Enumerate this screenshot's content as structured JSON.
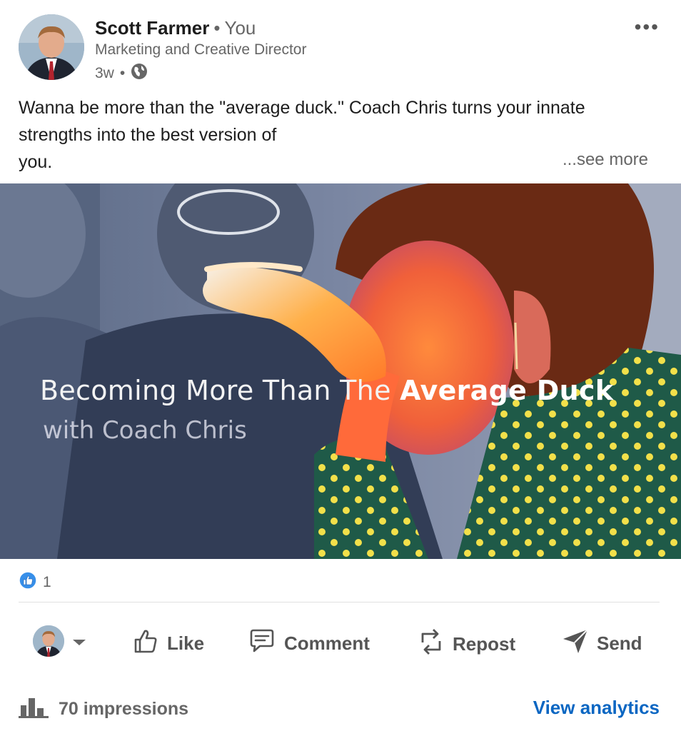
{
  "post": {
    "author": "Scott Farmer",
    "separator": "•",
    "relation": "You",
    "headline": "Marketing and Creative Director",
    "time": "3w",
    "meta_sep": "•",
    "more_menu": "•••",
    "text": "Wanna be more than the \"average duck.\" Coach Chris turns your innate strengths into the best version of",
    "text_tail": "you.",
    "see_more": "...see more"
  },
  "media": {
    "title_regular": "Becoming More Than The ",
    "title_bold": "Average Duck",
    "subtitle": "with Coach Chris"
  },
  "reactions": {
    "count": "1",
    "icon": "like-reaction-icon"
  },
  "actions": {
    "like": "Like",
    "comment": "Comment",
    "repost": "Repost",
    "send": "Send"
  },
  "footer": {
    "impressions": "70 impressions",
    "analytics": "View analytics"
  },
  "colors": {
    "link": "#0a66c2",
    "muted": "#666666",
    "text": "#1d1d1d",
    "reaction": "#378fe9"
  }
}
